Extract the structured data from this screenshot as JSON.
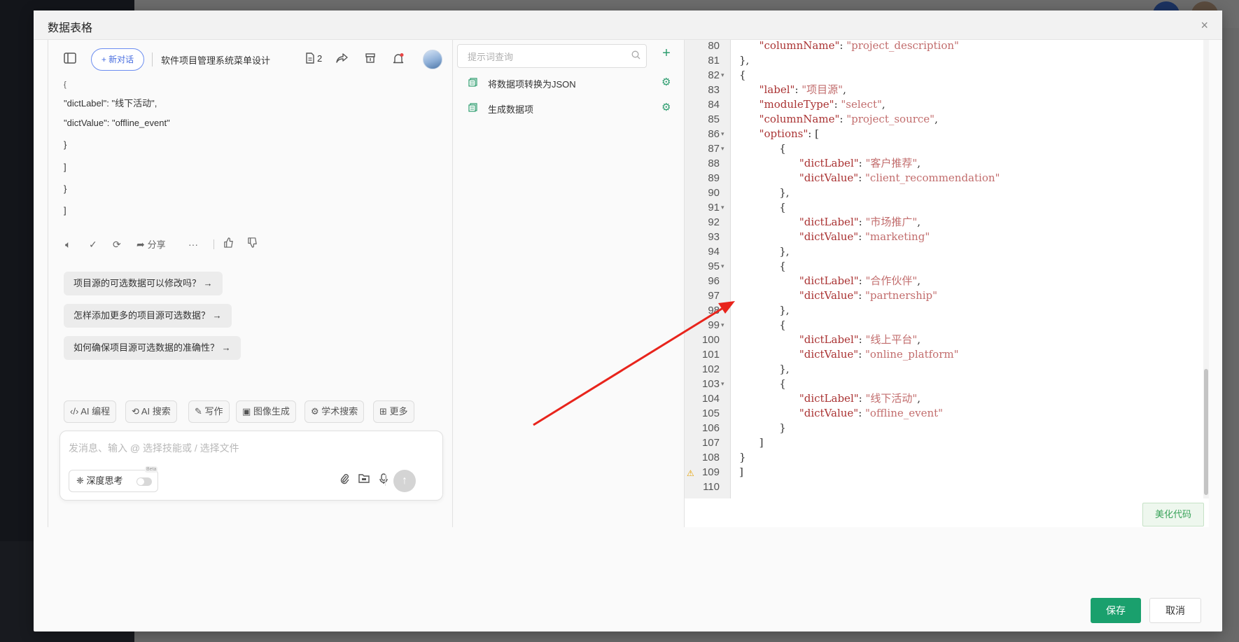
{
  "dialog": {
    "title": "数据表格",
    "close_icon": "×",
    "save_label": "保存",
    "cancel_label": "取消"
  },
  "chat": {
    "new_chat_label": "+ 新对话",
    "conversation_title": "软件项目管理系统菜单设计",
    "doc_count": "2",
    "message_lines": [
      "{",
      "\"dictLabel\": \"线下活动\",",
      "\"dictValue\": \"offline_event\"",
      "}",
      "]",
      "}",
      "]"
    ],
    "share_label": "分享",
    "suggestions": [
      "项目源的可选数据可以修改吗？ →",
      "怎样添加更多的项目源可选数据？ →",
      "如何确保项目源可选数据的准确性？ →"
    ],
    "skills": [
      "AI 编程",
      "AI 搜索",
      "写作",
      "图像生成",
      "学术搜索",
      "更多"
    ],
    "composer_placeholder": "发消息、输入 @ 选择技能或 / 选择文件",
    "deep_think_label": "深度思考",
    "beta_label": "Beta"
  },
  "prompts": {
    "search_placeholder": "提示词查询",
    "items": [
      "将数据项转换为JSON",
      "生成数据项"
    ]
  },
  "editor": {
    "beautify_label": "美化代码",
    "lines": [
      {
        "n": "80",
        "fold": false,
        "indent": 1,
        "key": "columnName",
        "val": "project_description",
        "tail": ""
      },
      {
        "n": "81",
        "fold": false,
        "indent": 0,
        "raw": "},"
      },
      {
        "n": "82",
        "fold": true,
        "indent": 0,
        "raw": "{"
      },
      {
        "n": "83",
        "fold": false,
        "indent": 1,
        "key": "label",
        "val": "项目源",
        "tail": ","
      },
      {
        "n": "84",
        "fold": false,
        "indent": 1,
        "key": "moduleType",
        "val": "select",
        "tail": ","
      },
      {
        "n": "85",
        "fold": false,
        "indent": 1,
        "key": "columnName",
        "val": "project_source",
        "tail": ","
      },
      {
        "n": "86",
        "fold": true,
        "indent": 1,
        "key": "options",
        "raw_after": ": ["
      },
      {
        "n": "87",
        "fold": true,
        "indent": 2,
        "raw": "{"
      },
      {
        "n": "88",
        "fold": false,
        "indent": 3,
        "key": "dictLabel",
        "val": "客户推荐",
        "tail": ","
      },
      {
        "n": "89",
        "fold": false,
        "indent": 3,
        "key": "dictValue",
        "val": "client_recommendation",
        "tail": ""
      },
      {
        "n": "90",
        "fold": false,
        "indent": 2,
        "raw": "},"
      },
      {
        "n": "91",
        "fold": true,
        "indent": 2,
        "raw": "{"
      },
      {
        "n": "92",
        "fold": false,
        "indent": 3,
        "key": "dictLabel",
        "val": "市场推广",
        "tail": ","
      },
      {
        "n": "93",
        "fold": false,
        "indent": 3,
        "key": "dictValue",
        "val": "marketing",
        "tail": ""
      },
      {
        "n": "94",
        "fold": false,
        "indent": 2,
        "raw": "},"
      },
      {
        "n": "95",
        "fold": true,
        "indent": 2,
        "raw": "{"
      },
      {
        "n": "96",
        "fold": false,
        "indent": 3,
        "key": "dictLabel",
        "val": "合作伙伴",
        "tail": ","
      },
      {
        "n": "97",
        "fold": false,
        "indent": 3,
        "key": "dictValue",
        "val": "partnership",
        "tail": ""
      },
      {
        "n": "98",
        "fold": false,
        "indent": 2,
        "raw": "},"
      },
      {
        "n": "99",
        "fold": true,
        "indent": 2,
        "raw": "{"
      },
      {
        "n": "100",
        "fold": false,
        "indent": 3,
        "key": "dictLabel",
        "val": "线上平台",
        "tail": ","
      },
      {
        "n": "101",
        "fold": false,
        "indent": 3,
        "key": "dictValue",
        "val": "online_platform",
        "tail": ""
      },
      {
        "n": "102",
        "fold": false,
        "indent": 2,
        "raw": "},"
      },
      {
        "n": "103",
        "fold": true,
        "indent": 2,
        "raw": "{"
      },
      {
        "n": "104",
        "fold": false,
        "indent": 3,
        "key": "dictLabel",
        "val": "线下活动",
        "tail": ","
      },
      {
        "n": "105",
        "fold": false,
        "indent": 3,
        "key": "dictValue",
        "val": "offline_event",
        "tail": ""
      },
      {
        "n": "106",
        "fold": false,
        "indent": 2,
        "raw": "}"
      },
      {
        "n": "107",
        "fold": false,
        "indent": 1,
        "raw": "]"
      },
      {
        "n": "108",
        "fold": false,
        "indent": 0,
        "raw": "}"
      },
      {
        "n": "109",
        "fold": false,
        "indent": 0,
        "raw": "]",
        "warn": true
      },
      {
        "n": "110",
        "fold": false,
        "indent": 0,
        "raw": ""
      }
    ]
  },
  "colors": {
    "accent_green": "#1aa06d",
    "accent_blue": "#4a6fe0",
    "annotation_arrow": "#e8241c"
  }
}
